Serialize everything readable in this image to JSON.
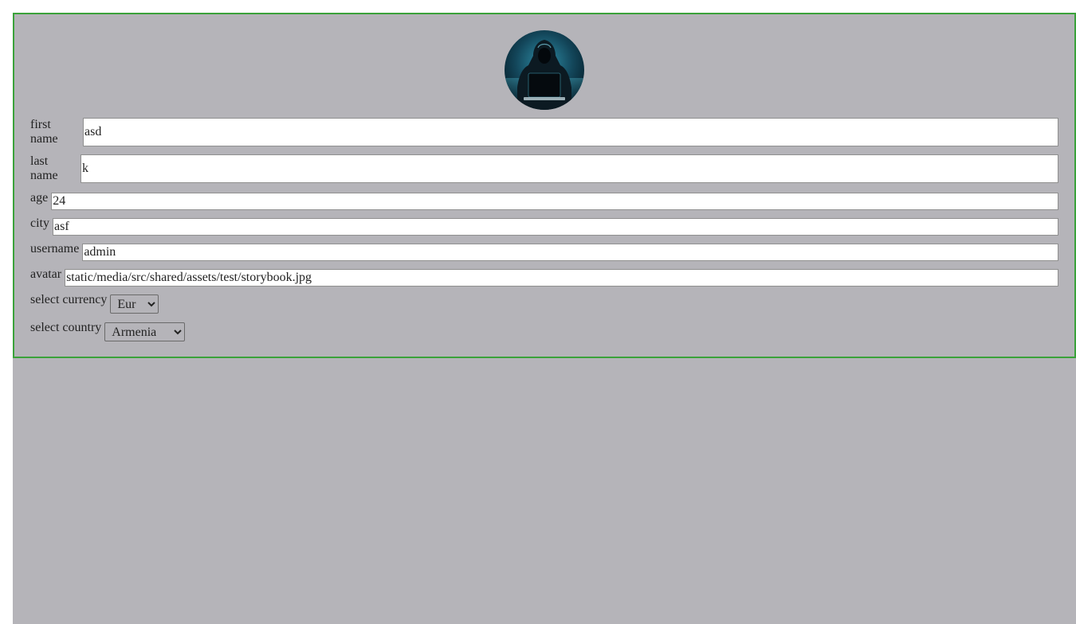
{
  "profile": {
    "fields": {
      "first_name": {
        "label": "first name",
        "value": "asd"
      },
      "last_name": {
        "label": "last name",
        "value": "k"
      },
      "age": {
        "label": "age",
        "value": "24"
      },
      "city": {
        "label": "city",
        "value": "asf"
      },
      "username": {
        "label": "username",
        "value": "admin"
      },
      "avatar": {
        "label": "avatar",
        "value": "static/media/src/shared/assets/test/storybook.jpg"
      }
    },
    "currency": {
      "label": "select currency",
      "selected": "Eur"
    },
    "country": {
      "label": "select country",
      "selected": "Armenia"
    }
  },
  "colors": {
    "card_border": "#3aa23a",
    "background": "#b5b4b9"
  },
  "icons": {
    "avatar": "hooded-hacker-avatar"
  }
}
